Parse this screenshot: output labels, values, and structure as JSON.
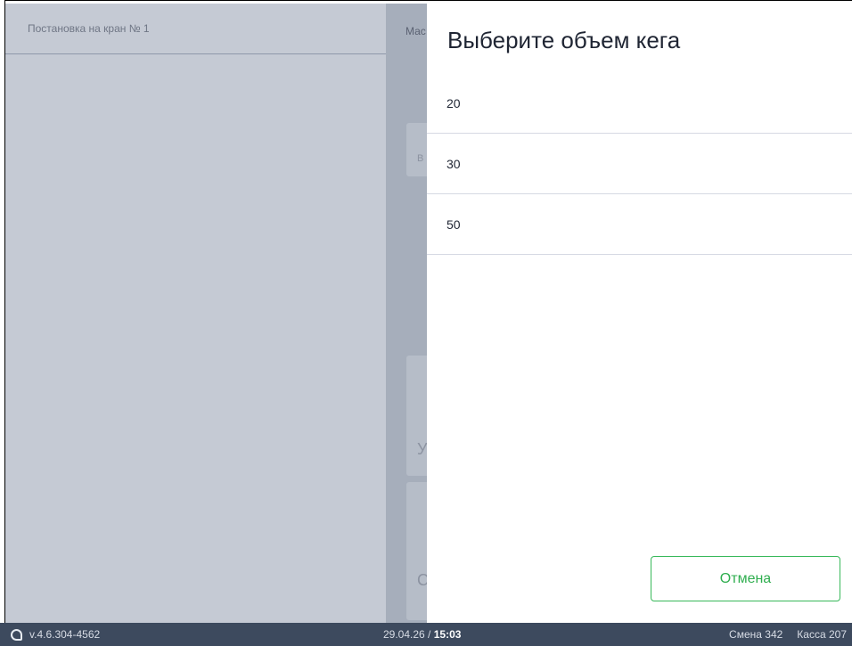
{
  "left_panel": {
    "header_title": "Постановка на кран № 1"
  },
  "middle_panel": {
    "header_text": "Мас",
    "block1_text": "В",
    "block2_text": "У",
    "block3_text": "С"
  },
  "modal": {
    "title": "Выберите объем кега",
    "options": [
      {
        "label": "20"
      },
      {
        "label": "30"
      },
      {
        "label": "50"
      }
    ],
    "cancel_label": "Отмена"
  },
  "status_bar": {
    "version": "v.4.6.304-4562",
    "date": "29.04.26",
    "separator": " / ",
    "time": "15:03",
    "shift": "Смена 342",
    "register": "Касса 207"
  },
  "colors": {
    "accent": "#38b85a",
    "status_bar_bg": "#3d4a5e",
    "overlay_left": "#c5cad4",
    "overlay_middle": "#a6aebb"
  },
  "icons": {
    "logo": "app-logo-icon"
  }
}
